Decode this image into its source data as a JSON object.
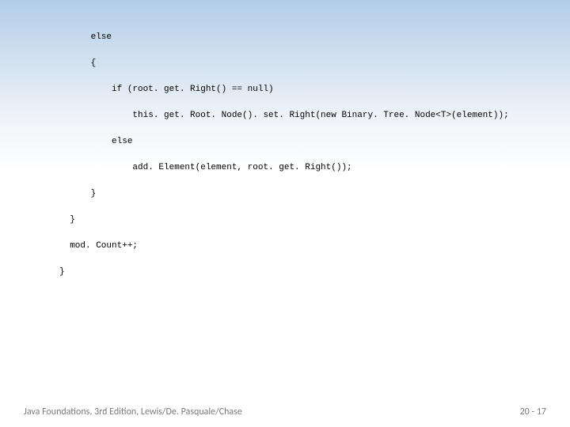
{
  "code": {
    "line1": "      else",
    "line2": "      {",
    "line3": "          if (root. get. Right() == null)",
    "line4": "              this. get. Root. Node(). set. Right(new Binary. Tree. Node<T>(element));",
    "line5": "          else",
    "line6": "              add. Element(element, root. get. Right());",
    "line7": "      }",
    "line8": "  }",
    "line9": "  mod. Count++;",
    "line10": "}"
  },
  "footer": {
    "left": "Java Foundations, 3rd Edition, Lewis/De. Pasquale/Chase",
    "right": "20 - 17"
  }
}
